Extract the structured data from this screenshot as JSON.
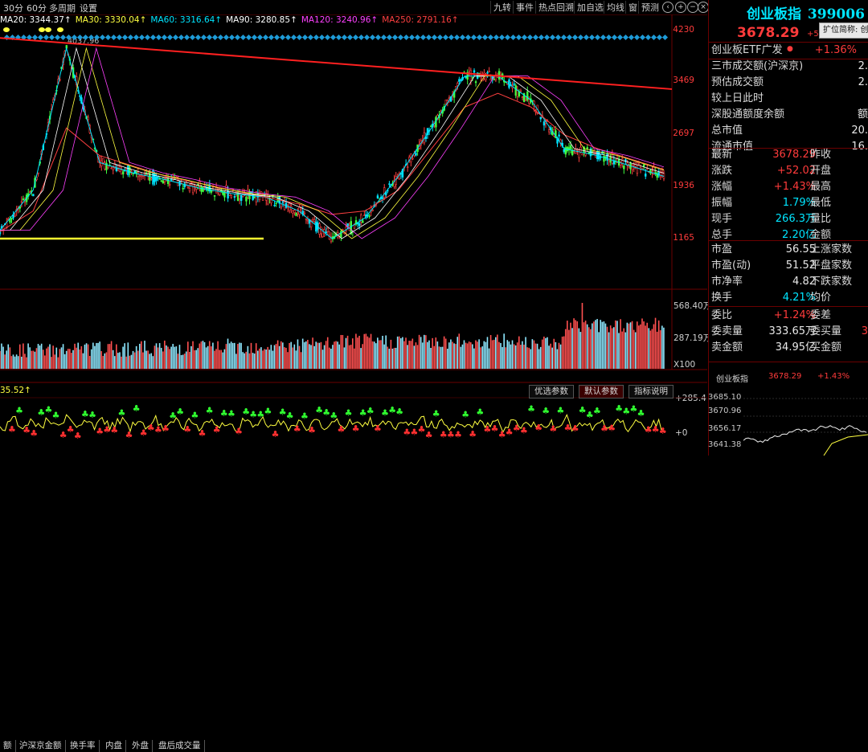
{
  "toolbar": {
    "left": [
      "30分",
      "60分",
      "多周期",
      "设置"
    ],
    "right": [
      "九转",
      "事件",
      "热点回溯",
      "加自选",
      "均线",
      "窗",
      "预测"
    ],
    "icons": [
      "prev-icon",
      "plus-icon",
      "minus-icon",
      "close-icon"
    ]
  },
  "ma_legend": [
    {
      "label": "MA20: 3344.37↑",
      "color": "#ffffff"
    },
    {
      "label": "MA30: 3330.04↑",
      "color": "#ffff40"
    },
    {
      "label": "MA60: 3316.64↑",
      "color": "#00e5ff"
    },
    {
      "label": "MA90: 3280.85↑",
      "color": "#ffffff"
    },
    {
      "label": "MA120: 3240.96↑",
      "color": "#ff40ff"
    },
    {
      "label": "MA250: 2791.16↑",
      "color": "#ff4040"
    }
  ],
  "price_axis": [
    "4230",
    "3469",
    "2697",
    "1936",
    "1165"
  ],
  "peak_label": "4037.96",
  "volume_axis": [
    "568.40万",
    "287.19万",
    "X100"
  ],
  "indicator_value": "35.52↑",
  "indicator_axis": [
    "+285.4",
    "+0"
  ],
  "bottom_tabs": [
    "额",
    "沪深京金额",
    "换手率",
    "内盘",
    "外盘",
    "盘后成交量"
  ],
  "indicator_tabs": [
    "优选参数",
    "默认参数",
    "指标说明"
  ],
  "chart_data": {
    "type": "line",
    "title": "",
    "xlabel": "",
    "ylabel": "",
    "ylim": [
      1165,
      4230
    ],
    "x": [
      0,
      5,
      10,
      15,
      20,
      25,
      30,
      35,
      40,
      45,
      50,
      55,
      60,
      65,
      70,
      75,
      80,
      85,
      90,
      95,
      100
    ],
    "series": [
      {
        "name": "",
        "values": [
          1320,
          1900,
          3950,
          2300,
          2150,
          2050,
          1930,
          1850,
          1800,
          1600,
          1200,
          1500,
          2100,
          2800,
          3550,
          3550,
          3200,
          2500,
          2400,
          2250,
          2100
        ]
      },
      {
        "name": "",
        "values": [
          1300,
          1600,
          2800,
          2400,
          2250,
          2100,
          2000,
          1900,
          1800,
          1700,
          1550,
          1600,
          1900,
          2500,
          3100,
          3300,
          3100,
          2700,
          2500,
          2350,
          2200
        ]
      }
    ]
  },
  "panel": {
    "title": "创业板指",
    "code": "399006",
    "price": "3678.29",
    "change_small": "+5",
    "tooltip": "扩位简称: 创",
    "etf_label": "创业板ETF广发",
    "etf_change": "+1.36%",
    "rows_top": [
      {
        "label": "三市成交额(沪深京)",
        "value": "2."
      },
      {
        "label": "预估成交额",
        "value": "2."
      },
      {
        "label": "较上日此时",
        "value": ""
      },
      {
        "label": "深股通额度余额",
        "value": "额"
      },
      {
        "label": "总市值",
        "value": "20."
      },
      {
        "label": "流通市值",
        "value": "16."
      }
    ],
    "rows_quote": [
      {
        "l1": "最新",
        "v1": "3678.29",
        "c1": "red",
        "l2": "昨收",
        "v2": "",
        "c2": "white"
      },
      {
        "l1": "涨跌",
        "v1": "+52.02",
        "c1": "red",
        "l2": "开盘",
        "v2": "",
        "c2": "white"
      },
      {
        "l1": "涨幅",
        "v1": "+1.43%",
        "c1": "red",
        "l2": "最高",
        "v2": "",
        "c2": "white"
      },
      {
        "l1": "振幅",
        "v1": "1.79%",
        "c1": "cyan",
        "l2": "最低",
        "v2": "",
        "c2": "white"
      },
      {
        "l1": "现手",
        "v1": "266.3万",
        "c1": "cyan",
        "l2": "量比",
        "v2": "",
        "c2": "white"
      },
      {
        "l1": "总手",
        "v1": "2.20亿",
        "c1": "cyan",
        "l2": "金额",
        "v2": "",
        "c2": "white"
      }
    ],
    "rows_val": [
      {
        "l1": "市盈",
        "v1": "56.55",
        "c1": "white",
        "l2": "上涨家数",
        "v2": "",
        "c2": "white"
      },
      {
        "l1": "市盈(动)",
        "v1": "51.52",
        "c1": "white",
        "l2": "平盘家数",
        "v2": "",
        "c2": "white"
      },
      {
        "l1": "市净率",
        "v1": "4.82",
        "c1": "white",
        "l2": "下跌家数",
        "v2": "",
        "c2": "white"
      },
      {
        "l1": "换手",
        "v1": "4.21%",
        "c1": "cyan",
        "l2": "均价",
        "v2": "",
        "c2": "white"
      }
    ],
    "rows_order": [
      {
        "l1": "委比",
        "v1": "+1.24%",
        "c1": "red",
        "l2": "委差",
        "v2": "",
        "c2": "white"
      },
      {
        "l1": "委卖量",
        "v1": "333.65万",
        "c1": "white",
        "l2": "委买量",
        "v2": "3",
        "c2": "red"
      },
      {
        "l1": "卖金额",
        "v1": "34.95亿",
        "c1": "white",
        "l2": "买金额",
        "v2": "",
        "c2": "white"
      }
    ],
    "mini": {
      "name": "创业板指",
      "price": "3678.29",
      "change": "+1.43%",
      "axis": [
        "3685.10",
        "3670.96",
        "3656.17",
        "3641.38"
      ]
    }
  }
}
